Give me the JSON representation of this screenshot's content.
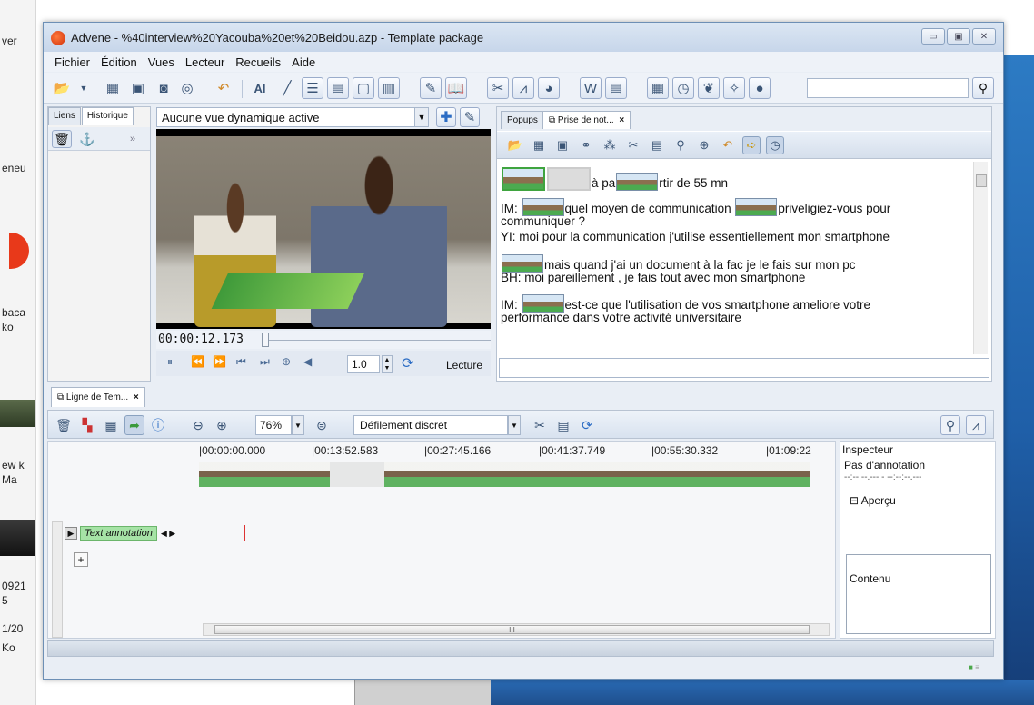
{
  "desktop": {
    "fragments": [
      "ver",
      "eneu",
      "baca",
      "ko",
      "ew k",
      "Ma",
      "0921",
      "5",
      "1/20",
      "Ko"
    ]
  },
  "window": {
    "title": "Advene - %40interview%20Yacouba%20et%20Beidou.azp - Template package",
    "controls": [
      "minimize-icon",
      "maximize-icon",
      "close-icon"
    ]
  },
  "menu": [
    "Fichier",
    "Édition",
    "Vues",
    "Lecteur",
    "Recueils",
    "Aide"
  ],
  "toolbar": {
    "ai_label": "AI",
    "search_value": ""
  },
  "left_panel": {
    "tabs": [
      "Liens",
      "Historique"
    ],
    "more": "»"
  },
  "player": {
    "view_select": "Aucune vue dynamique active",
    "timecode": "00:00:12.173",
    "rate": "1.0",
    "mode": "Lecture"
  },
  "notes": {
    "tabs": [
      "Popups",
      "Prise de not..."
    ],
    "close": "×",
    "lines": [
      {
        "pre": "",
        "mid": "à pa",
        "post": "rtir de 55 mn"
      },
      {
        "pre": "IM:",
        "mid": "quel moyen de communication",
        "post": "priveligiez-vous pour"
      },
      {
        "pre": "communiquer ?",
        "mid": "",
        "post": ""
      },
      {
        "pre": "YI: moi pour la communication j'utilise essentiellement mon smartphone",
        "mid": "",
        "post": ""
      },
      {
        "pre": "",
        "mid": "mais quand j'ai un document à la fac je le fais sur mon pc",
        "post": ""
      },
      {
        "pre": "BH: moi pareillement , je fais tout avec mon smartphone",
        "mid": "",
        "post": ""
      },
      {
        "pre": "IM:",
        "mid": "est-ce que l'utilisation de vos smartphone ameliore votre",
        "post": ""
      },
      {
        "pre": "performance dans votre activité universitaire",
        "mid": "",
        "post": ""
      }
    ]
  },
  "timeline": {
    "tab": "Ligne de Tem...",
    "close": "×",
    "zoom": "76%",
    "scroll_mode": "Défilement discret",
    "ticks": [
      "00:00:00.000",
      "00:13:52.583",
      "00:27:45.166",
      "00:41:37.749",
      "00:55:30.332",
      "01:09:22"
    ],
    "track_label": "Text annotation",
    "add": "+",
    "hscroll_grip": "III"
  },
  "inspector": {
    "title": "Inspecteur",
    "subtitle": "Pas d'annotation",
    "dashes": "--:--:--.--- - --:--:--.---",
    "apercu": "Aperçu",
    "contenu": "Contenu"
  }
}
